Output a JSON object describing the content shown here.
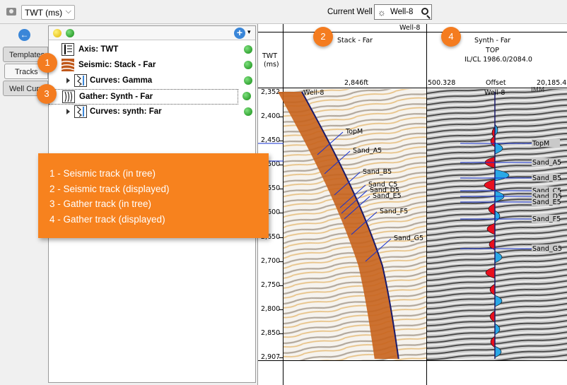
{
  "toolbar": {
    "domain_value": "TWT (ms)",
    "current_well_label": "Current Well",
    "current_well_value": "Well-8"
  },
  "side_tabs": [
    {
      "label": "Templates"
    },
    {
      "label": "Tracks"
    },
    {
      "label": "Well Curves"
    }
  ],
  "tree": {
    "items": [
      {
        "label": "Axis: TWT"
      },
      {
        "label": "Seismic: Stack - Far"
      },
      {
        "label": "Curves: Gamma"
      },
      {
        "label": "Gather: Synth - Far"
      },
      {
        "label": "Curves: synth: Far"
      }
    ]
  },
  "callouts": {
    "badges": [
      "1",
      "2",
      "3",
      "4"
    ],
    "legend": [
      "1 - Seismic track (in tree)",
      "2 - Seismic track (displayed)",
      "3 - Gather track (in tree)",
      "4 - Gather track (displayed)"
    ]
  },
  "display": {
    "well_title": "Well-8",
    "axis_header": [
      "TWT",
      "(ms)"
    ],
    "seismic_track": {
      "title": "Stack - Far",
      "scale_label": "2,846ft",
      "well_label": "Well-8"
    },
    "gather_track": {
      "title": "Synth - Far",
      "subtitle": "TOP",
      "ilcl": "IL/CL 1986.0/2084.0",
      "offset_min": "500.328",
      "offset_label": "Offset",
      "offset_max": "20,185.4",
      "well_label": "Well-8",
      "corner_label": "IMM"
    },
    "ticks": [
      "2,352",
      "2,400",
      "2,450",
      "2,500",
      "2,550",
      "2,600",
      "2,650",
      "2,700",
      "2,750",
      "2,800",
      "2,850",
      "2,907"
    ],
    "seismic_tops": [
      "TopM",
      "Sand_A5",
      "Sand_B5",
      "Sand_C5",
      "Sand_D5",
      "Sand_E5",
      "Sand_F5",
      "Sand_G5"
    ],
    "gather_tops": [
      "TopM",
      "Sand_A5",
      "Sand_B5",
      "Sand_C5",
      "Sand_D5",
      "Sand_E5",
      "Sand_F5",
      "Sand_G5"
    ]
  },
  "colors": {
    "callout": "#f47c20",
    "accent": "#3a86d8",
    "wiggle_red": "#e8101e",
    "wiggle_blue": "#29a8e6",
    "horizon": "#1530d0"
  }
}
